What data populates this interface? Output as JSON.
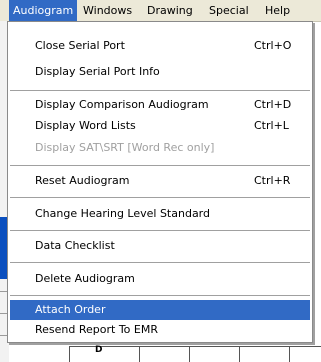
{
  "menubar": {
    "items": [
      "Audiogram",
      "Windows",
      "Drawing",
      "Special",
      "Help"
    ]
  },
  "menu": {
    "items": [
      {
        "label": "Close Serial Port",
        "shortcut": "Ctrl+O"
      },
      {
        "label": "Display Serial Port Info",
        "shortcut": ""
      },
      {
        "label": "Display Comparison Audiogram",
        "shortcut": "Ctrl+D"
      },
      {
        "label": "Display Word Lists",
        "shortcut": "Ctrl+L"
      },
      {
        "label": "Display SAT\\SRT [Word Rec only]",
        "shortcut": "",
        "disabled": true
      },
      {
        "label": "Reset Audiogram",
        "shortcut": "Ctrl+R"
      },
      {
        "label": "Change Hearing Level Standard",
        "shortcut": ""
      },
      {
        "label": "Data Checklist",
        "shortcut": ""
      },
      {
        "label": "Delete Audiogram",
        "shortcut": ""
      },
      {
        "label": "Attach Order",
        "shortcut": "",
        "selected": true
      },
      {
        "label": "Resend Report To EMR",
        "shortcut": ""
      }
    ]
  },
  "background": {
    "axis_label": "D"
  },
  "colors": {
    "highlight": "#316ac5",
    "menubar": "#ece9d8",
    "disabled_text": "#a0a0a0"
  }
}
